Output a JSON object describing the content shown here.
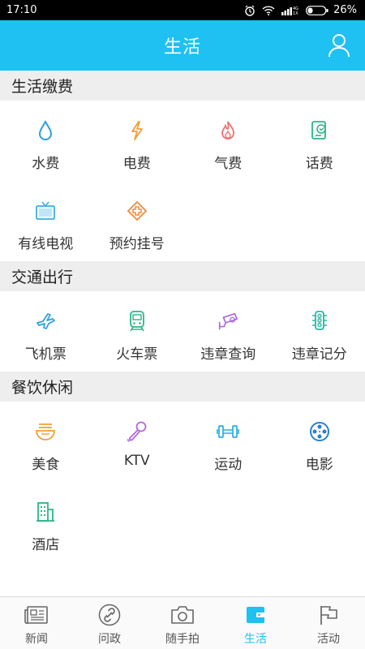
{
  "status": {
    "time": "17:10",
    "network": "4G 1X",
    "battery": "26%"
  },
  "header": {
    "title": "生活"
  },
  "sections": [
    {
      "title": "生活缴费",
      "items": [
        {
          "label": "水费",
          "icon": "water-drop-icon"
        },
        {
          "label": "电费",
          "icon": "lightning-icon"
        },
        {
          "label": "气费",
          "icon": "flame-icon"
        },
        {
          "label": "话费",
          "icon": "phone-bill-icon"
        },
        {
          "label": "有线电视",
          "icon": "tv-icon"
        },
        {
          "label": "预约挂号",
          "icon": "medical-cross-icon"
        }
      ]
    },
    {
      "title": "交通出行",
      "items": [
        {
          "label": "飞机票",
          "icon": "airplane-icon"
        },
        {
          "label": "火车票",
          "icon": "train-icon"
        },
        {
          "label": "违章查询",
          "icon": "traffic-camera-icon"
        },
        {
          "label": "违章记分",
          "icon": "traffic-light-icon"
        }
      ]
    },
    {
      "title": "餐饮休闲",
      "items": [
        {
          "label": "美食",
          "icon": "food-bowl-icon"
        },
        {
          "label": "KTV",
          "icon": "microphone-icon"
        },
        {
          "label": "运动",
          "icon": "dumbbell-icon"
        },
        {
          "label": "电影",
          "icon": "film-reel-icon"
        },
        {
          "label": "酒店",
          "icon": "hotel-building-icon"
        }
      ]
    }
  ],
  "nav": [
    {
      "label": "新闻",
      "icon": "newspaper-icon"
    },
    {
      "label": "问政",
      "icon": "link-icon"
    },
    {
      "label": "随手拍",
      "icon": "camera-icon"
    },
    {
      "label": "生活",
      "icon": "wallet-icon",
      "active": true
    },
    {
      "label": "活动",
      "icon": "flag-icon"
    }
  ],
  "colors": {
    "accent": "#1ec1f1",
    "water": "#2a9fe0",
    "electric": "#f0a030",
    "gas": "#f07070",
    "phone": "#2ab58a",
    "tv": "#3aaee0",
    "hospital": "#f08a3c",
    "plane": "#2a9fe0",
    "train": "#2ab58a",
    "camera": "#b068e0",
    "light": "#2ab5a0",
    "food": "#f0a030",
    "ktv": "#b068e0",
    "sport": "#2aaee0",
    "movie": "#2a7fd0",
    "hotel": "#2ab58a"
  }
}
